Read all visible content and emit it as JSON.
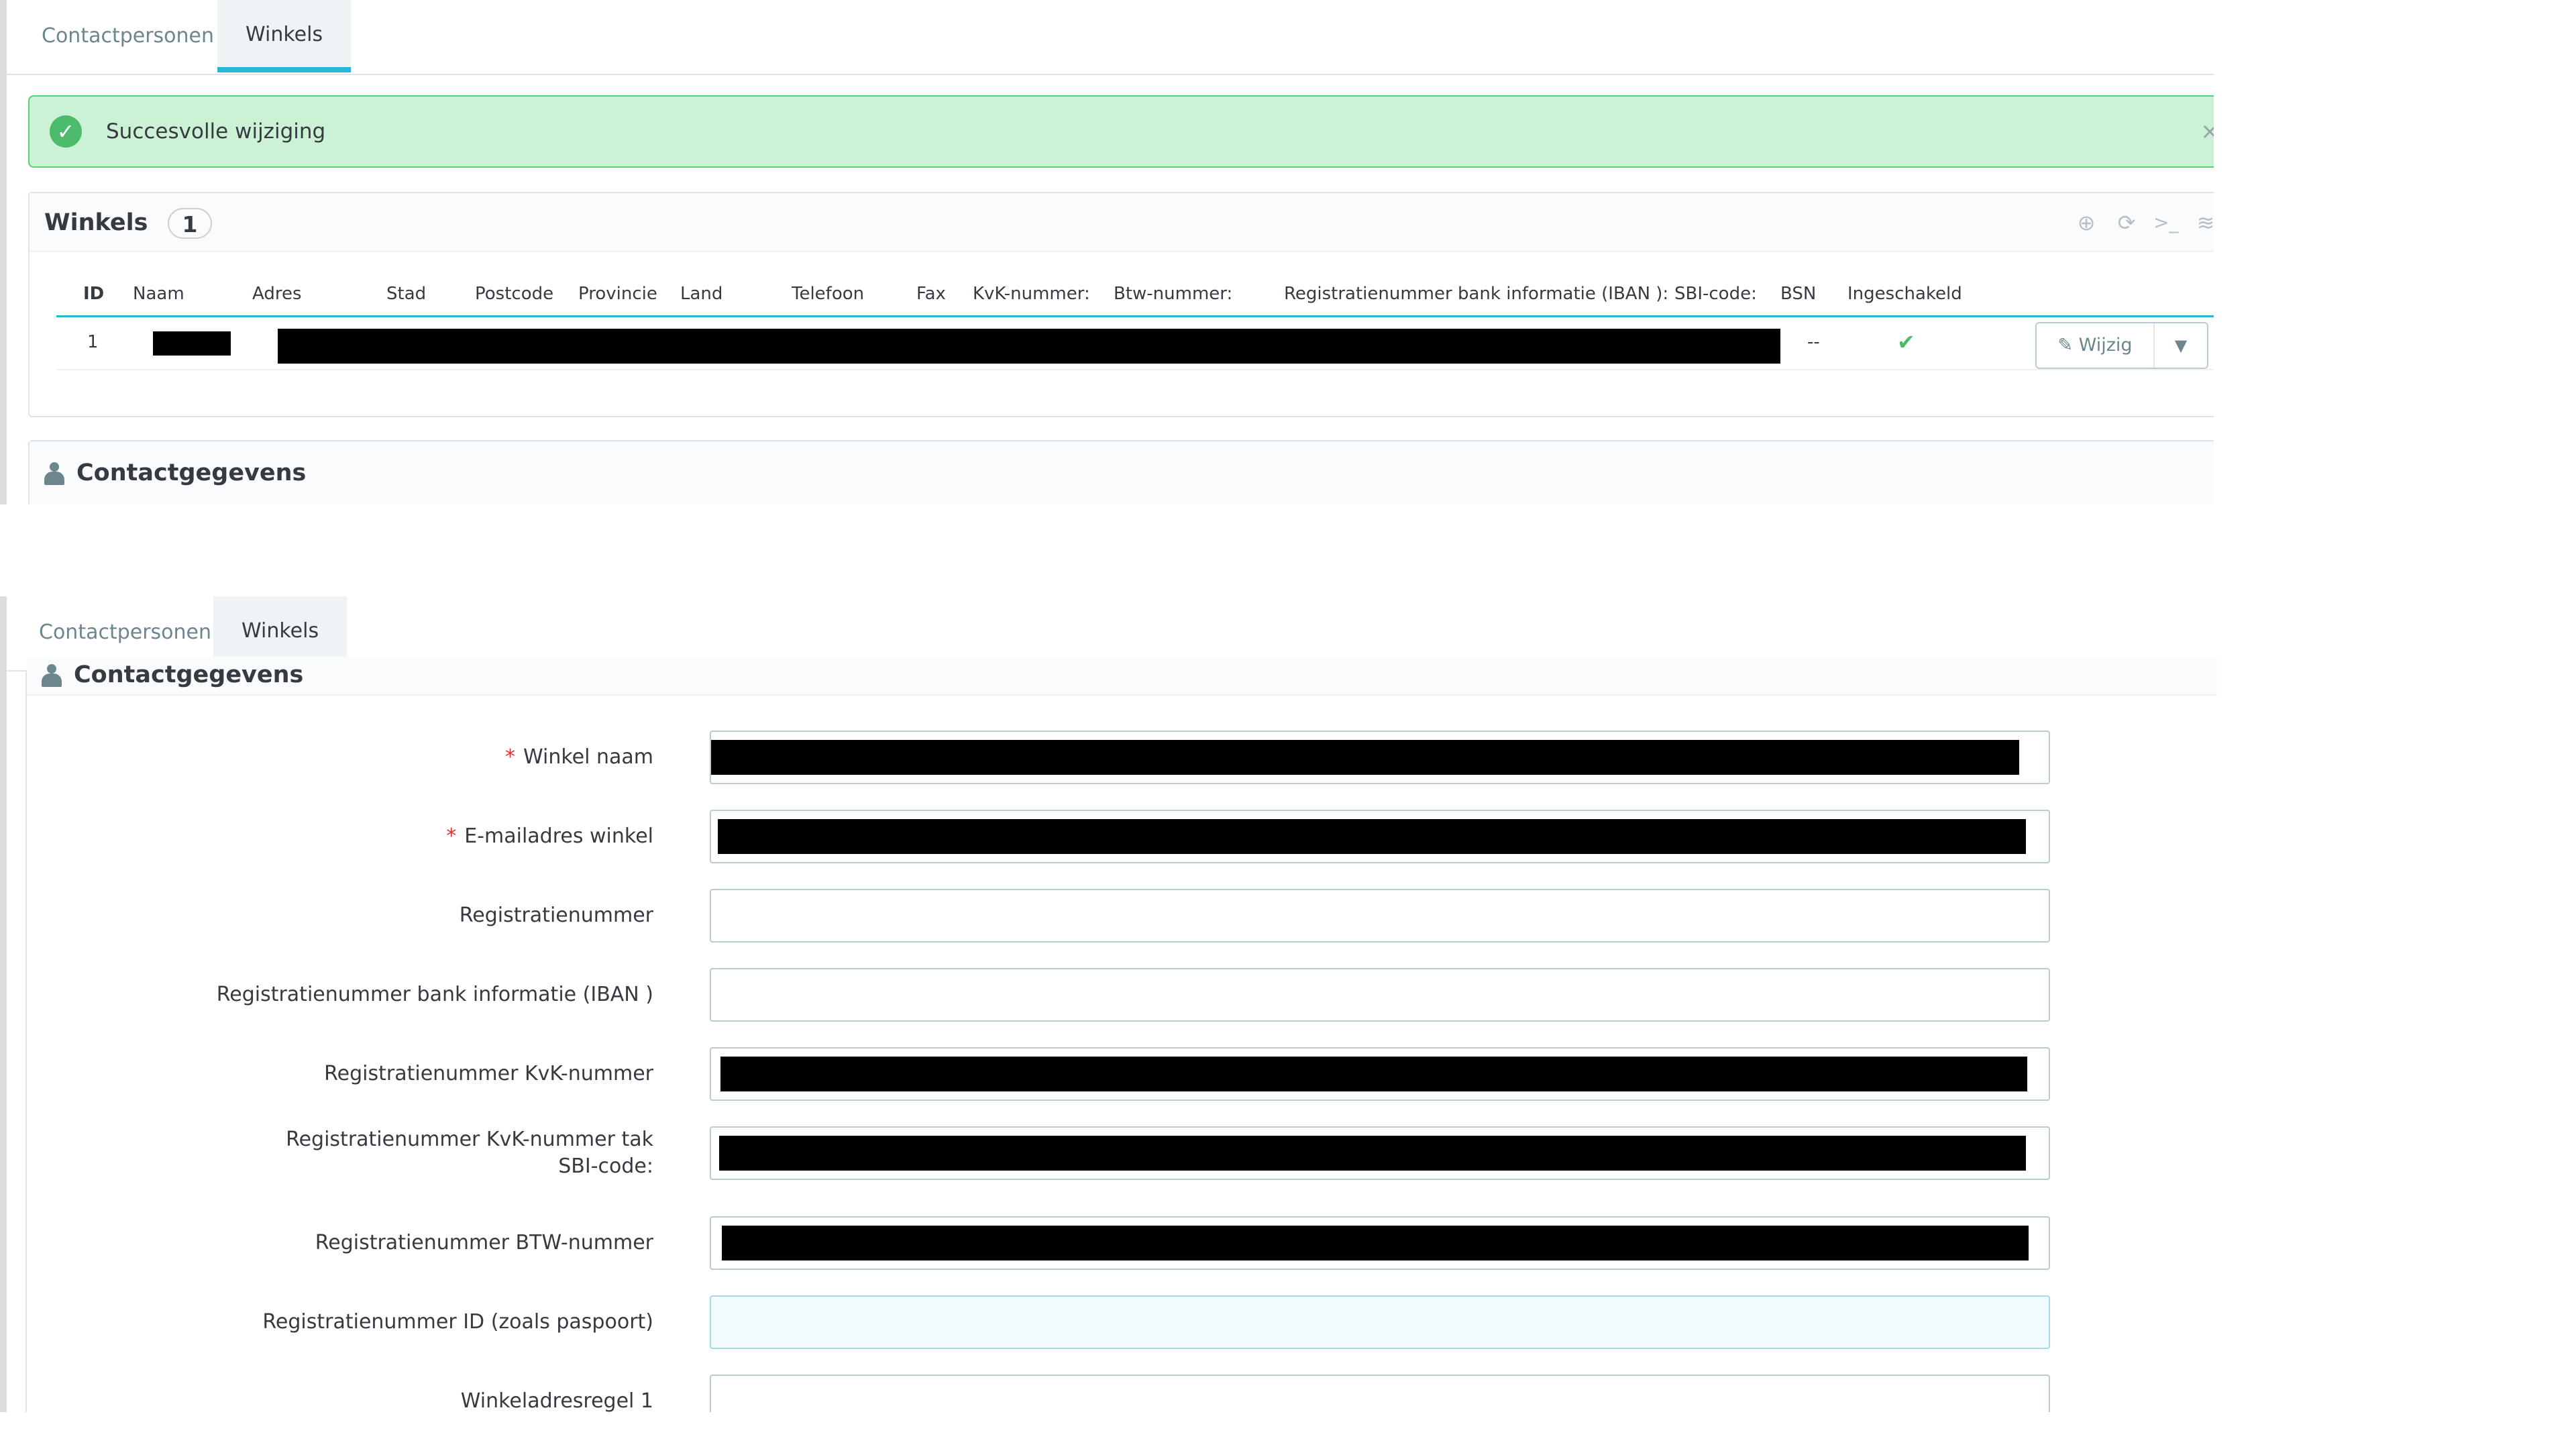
{
  "tabs": [
    {
      "label": "Contactpersonen",
      "active": false
    },
    {
      "label": "Winkels",
      "active": true
    }
  ],
  "alert": {
    "message": "Succesvolle wijziging",
    "close": "×"
  },
  "winkels_panel": {
    "title": "Winkels",
    "count": "1",
    "toolbar_icons": [
      "add-icon",
      "refresh-icon",
      "terminal-icon",
      "database-icon"
    ],
    "toolbar_glyphs": {
      "add": "⊕",
      "refresh": "⟳",
      "terminal": ">_",
      "database": "≋"
    },
    "columns": [
      "ID",
      "Naam",
      "Adres",
      "Stad",
      "Postcode",
      "Provincie",
      "Land",
      "Telefoon",
      "Fax",
      "KvK-nummer:",
      "Btw-nummer:",
      "Registratienummer bank informatie (IBAN ):",
      "SBI-code:",
      "BSN",
      "Ingeschakeld"
    ],
    "rows": [
      {
        "id": "1",
        "bsn": "--",
        "enabled": "✔",
        "action": "Wijzig",
        "pencil": "✎",
        "caret": "▼"
      }
    ]
  },
  "contact_section": {
    "title": "Contactgegevens"
  },
  "form": {
    "required_mark": "*",
    "fields": [
      {
        "label": "Winkel naam",
        "required": true
      },
      {
        "label": "E-mailadres winkel",
        "required": true
      },
      {
        "label": "Registratienummer",
        "required": false
      },
      {
        "label": "Registratienummer bank informatie (IBAN )",
        "required": false
      },
      {
        "label": "Registratienummer KvK-nummer",
        "required": false
      },
      {
        "label": "Registratienummer KvK-nummer tak SBI-code:",
        "required": false
      },
      {
        "label": "Registratienummer BTW-nummer",
        "required": false
      },
      {
        "label": "Registratienummer ID (zoals paspoort)",
        "required": false
      },
      {
        "label": "Winkeladresregel 1",
        "required": false
      }
    ]
  },
  "colors": {
    "accent": "#25b9d7",
    "success_bg": "#cbf2d4",
    "success_border": "#53d572",
    "check": "#4cbb6c",
    "required": "#e02f2f"
  }
}
